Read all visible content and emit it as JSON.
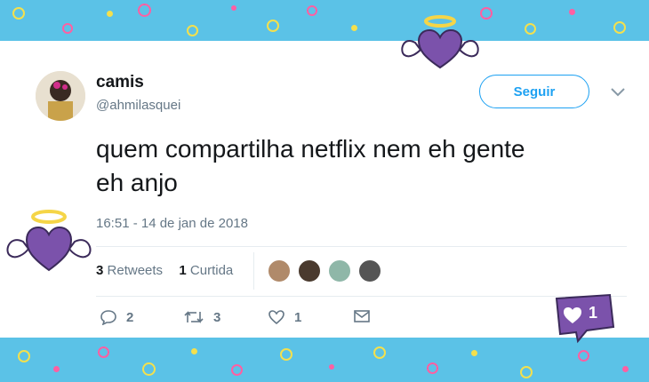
{
  "tweet": {
    "display_name": "camis",
    "handle": "@ahmilasquei",
    "follow_label": "Seguir",
    "text_lines": [
      "quem compartilha netflix nem eh gente",
      "eh anjo"
    ],
    "timestamp": "16:51 - 14 de jan de 2018",
    "stats": {
      "retweets_count": "3",
      "retweets_label": "Retweets",
      "likes_count": "1",
      "likes_label": "Curtida"
    },
    "actions": {
      "reply_count": "2",
      "retweet_count": "3",
      "like_count": "1"
    }
  },
  "stickers": {
    "like_badge_count": "1"
  },
  "colors": {
    "background_band": "#5bc2e7",
    "accent": "#1da1f2",
    "sticker_purple": "#7b52ab",
    "halo_yellow": "#f5d547"
  }
}
